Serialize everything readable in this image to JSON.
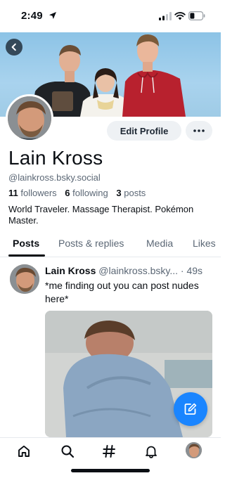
{
  "status_bar": {
    "time": "2:49"
  },
  "profile": {
    "display_name": "Lain Kross",
    "handle": "@lainkross.bsky.social",
    "followers_count": "11",
    "followers_label": "followers",
    "following_count": "6",
    "following_label": "following",
    "posts_count": "3",
    "posts_label": "posts",
    "bio": "World Traveler. Massage Therapist. Pokémon Master.",
    "edit_label": "Edit Profile"
  },
  "tabs": [
    {
      "label": "Posts",
      "active": true
    },
    {
      "label": "Posts & replies",
      "active": false
    },
    {
      "label": "Media",
      "active": false
    },
    {
      "label": "Likes",
      "active": false
    }
  ],
  "post": {
    "author": "Lain Kross",
    "handle": "@lainkross.bsky...",
    "time": "· 49s",
    "text": "*me finding out you can post nudes here*"
  },
  "colors": {
    "accent": "#1a85ff",
    "text": "#0b0f14",
    "muted": "#5b6775"
  },
  "icons": {
    "nav": [
      "home-icon",
      "search-icon",
      "hashtag-icon",
      "bell-icon",
      "profile-avatar"
    ],
    "compose": "pencil-icon"
  }
}
